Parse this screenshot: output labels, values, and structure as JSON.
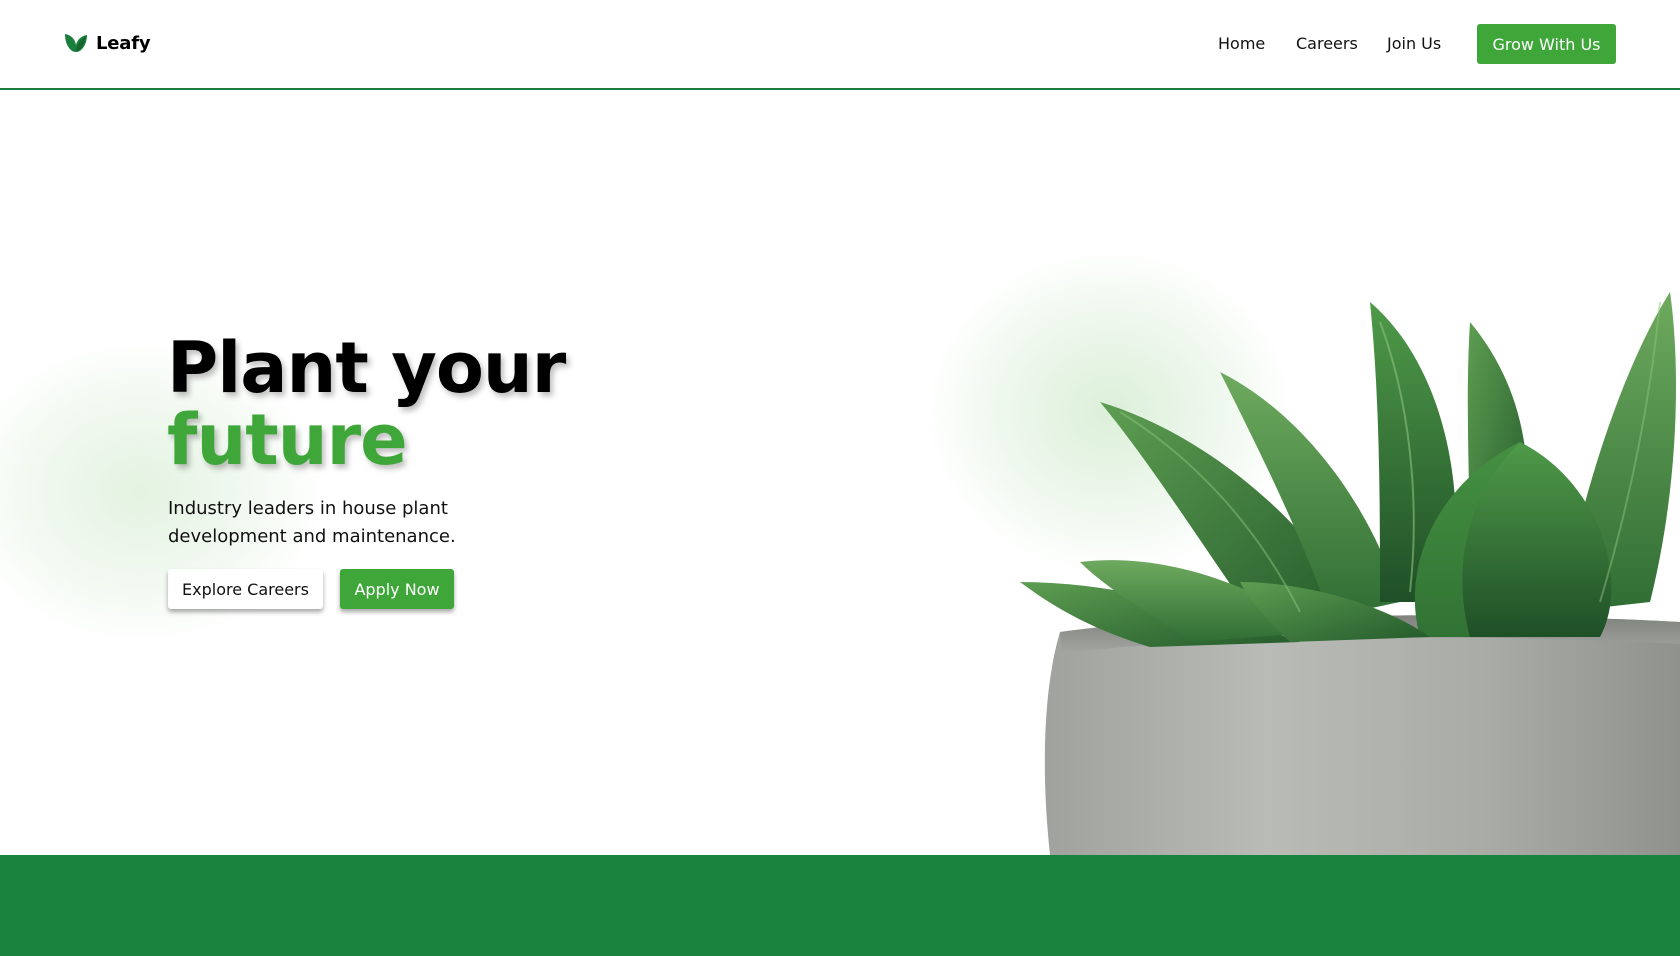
{
  "brand": {
    "name": "Leafy",
    "logo_icon": "leaf-icon"
  },
  "nav": {
    "links": [
      "Home",
      "Careers",
      "Join Us"
    ],
    "cta": "Grow With Us"
  },
  "hero": {
    "title_line1": "Plant your",
    "title_line2": "future",
    "subtitle": "Industry leaders in house plant development and maintenance.",
    "buttons": {
      "explore": "Explore Careers",
      "apply": "Apply Now"
    },
    "image": "succulent-in-concrete-pot"
  },
  "colors": {
    "accent": "#3fa73a",
    "dark_green": "#1a843c",
    "text": "#000000",
    "background": "#ffffff"
  }
}
